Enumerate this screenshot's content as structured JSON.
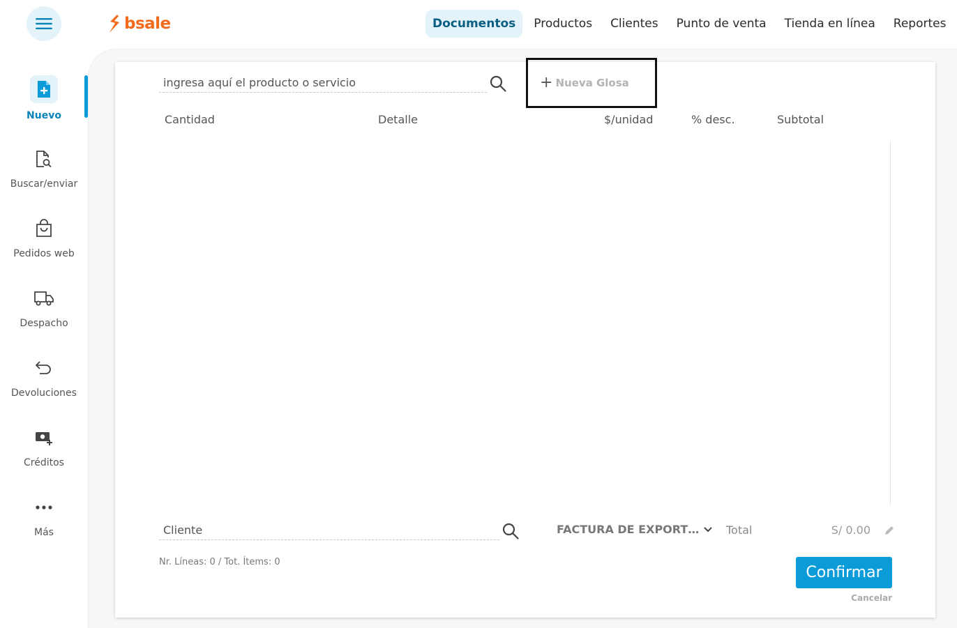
{
  "brand": {
    "name": "bsale",
    "color": "#f26a1b"
  },
  "topnav": {
    "items": [
      {
        "label": "Documentos",
        "active": true
      },
      {
        "label": "Productos"
      },
      {
        "label": "Clientes"
      },
      {
        "label": "Punto de venta"
      },
      {
        "label": "Tienda en línea"
      },
      {
        "label": "Reportes"
      }
    ]
  },
  "sidebar": {
    "items": [
      {
        "label": "Nuevo",
        "icon": "file-plus-icon",
        "active": true
      },
      {
        "label": "Buscar/enviar",
        "icon": "file-search-icon"
      },
      {
        "label": "Pedidos web",
        "icon": "shopping-bag-icon"
      },
      {
        "label": "Despacho",
        "icon": "truck-icon"
      },
      {
        "label": "Devoluciones",
        "icon": "return-arrow-icon"
      },
      {
        "label": "Créditos",
        "icon": "money-plus-icon"
      },
      {
        "label": "Más",
        "icon": "more-dots-icon"
      }
    ]
  },
  "product_search": {
    "placeholder": "ingresa aquí el producto o servicio"
  },
  "glosa": {
    "label": "Nueva Glosa"
  },
  "table": {
    "columns": [
      "Cantidad",
      "Detalle",
      "$/unidad",
      "% desc.",
      "Subtotal"
    ]
  },
  "client_search": {
    "placeholder": "Cliente"
  },
  "document_type": {
    "label": "FACTURA DE EXPORT…"
  },
  "total": {
    "label": "Total",
    "value": "S/ 0.00"
  },
  "lines_info": "Nr. Líneas: 0 / Tot. Ítems: 0",
  "actions": {
    "confirm": "Confirmar",
    "cancel": "Cancelar"
  },
  "colors": {
    "accent": "#0a9bd8",
    "active_bg": "#e4f3fa",
    "active_text": "#0a5e84"
  }
}
